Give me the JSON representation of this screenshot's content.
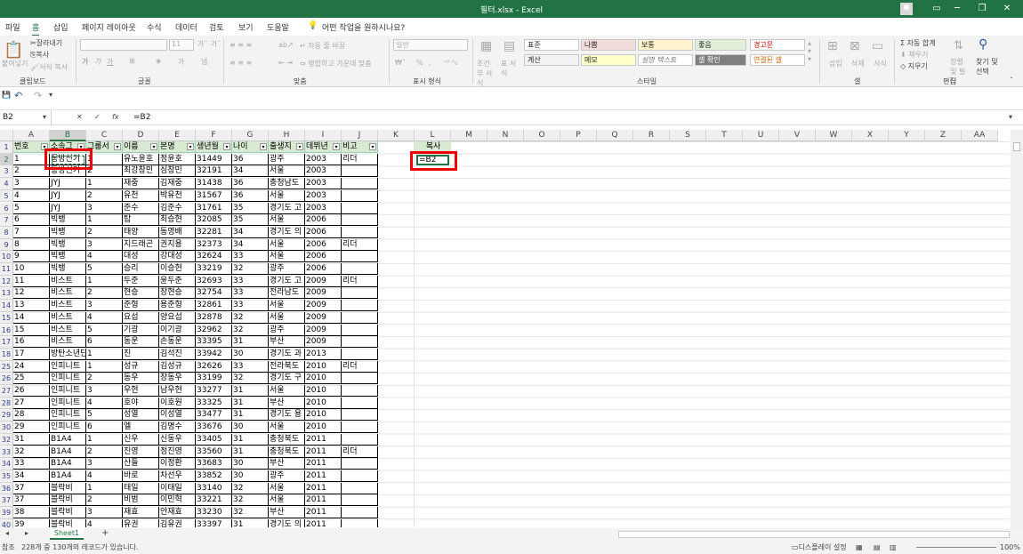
{
  "window": {
    "title": "필터.xlsx  -  Excel",
    "minimize": "─",
    "restore": "❐",
    "close": "✕",
    "ribbon_toggle": "▭"
  },
  "tabs": [
    "파일",
    "홈",
    "삽입",
    "페이지 레이아웃",
    "수식",
    "데이터",
    "검토",
    "보기",
    "도움말"
  ],
  "active_tab": "홈",
  "tell_me": "어떤 작업을 원하시나요?",
  "share": "공유",
  "ribbon": {
    "groups": [
      "클립보드",
      "글꼴",
      "맞춤",
      "표시 형식",
      "스타일",
      "셀",
      "편집"
    ],
    "clipboard": {
      "paste": "붙여넣기",
      "cut": "잘라내기",
      "copy": "복사",
      "format_painter": "서식 복사"
    },
    "font": {
      "name": "",
      "size": "11",
      "bold": "가",
      "italic": "가",
      "underline": "가"
    },
    "align": {
      "wrap": "자동 줄 바꿈",
      "merge": "병합하고 가운데 맞춤"
    },
    "number": {
      "format": "일반",
      "percent": "%"
    },
    "styles": {
      "conditional": "조건부 서식",
      "table": "표 서식",
      "cells": [
        "표준",
        "나쁨",
        "보통",
        "좋음",
        "경고문",
        "계산",
        "메모",
        "설명 텍스트",
        "셀 확인",
        "연결된 셀"
      ]
    },
    "cells": {
      "insert": "삽입",
      "delete": "삭제",
      "format": "서식"
    },
    "editing": {
      "autosum": "자동 합계",
      "fill": "채우기",
      "clear": "지우기",
      "sort": "정렬 및 필터",
      "find": "찾기 및 선택"
    }
  },
  "qat": {
    "save": "💾",
    "undo": "↶",
    "redo": "↷"
  },
  "formula_bar": {
    "name_box": "B2",
    "cancel": "✕",
    "enter": "✓",
    "fx": "fx",
    "formula": "=B2"
  },
  "columns": [
    "A",
    "B",
    "C",
    "D",
    "E",
    "F",
    "G",
    "H",
    "I",
    "J",
    "K",
    "L",
    "M",
    "N",
    "O",
    "P",
    "Q",
    "R",
    "S",
    "T",
    "U",
    "V",
    "W",
    "X",
    "Y",
    "Z",
    "AA"
  ],
  "headers": [
    "번호",
    "소속그",
    "그룹서",
    "이름",
    "본명",
    "생년월",
    "나이",
    "출생지",
    "데뷔년",
    "비고"
  ],
  "copy_label": "복사",
  "copy_cell": "=B2",
  "rows": [
    {
      "r": "1",
      "v": []
    },
    {
      "r": "2",
      "v": [
        "1",
        "동방신기",
        "1",
        "유노윤호",
        "정윤호",
        "31449",
        "36",
        "광주",
        "2003",
        "리더"
      ]
    },
    {
      "r": "3",
      "v": [
        "2",
        "동방신기",
        "2",
        "최강창민",
        "심창민",
        "32191",
        "34",
        "서울",
        "2003",
        ""
      ]
    },
    {
      "r": "4",
      "v": [
        "3",
        "JYJ",
        "1",
        "재중",
        "김재중",
        "31438",
        "36",
        "충청남도",
        "2003",
        ""
      ]
    },
    {
      "r": "5",
      "v": [
        "4",
        "JYJ",
        "2",
        "유천",
        "박유천",
        "31567",
        "36",
        "서울",
        "2003",
        ""
      ]
    },
    {
      "r": "6",
      "v": [
        "5",
        "JYJ",
        "3",
        "준수",
        "김준수",
        "31761",
        "35",
        "경기도 고",
        "2003",
        ""
      ]
    },
    {
      "r": "7",
      "v": [
        "6",
        "빅뱅",
        "1",
        "탑",
        "최승현",
        "32085",
        "35",
        "서울",
        "2006",
        ""
      ]
    },
    {
      "r": "8",
      "v": [
        "7",
        "빅뱅",
        "2",
        "태양",
        "동영배",
        "32281",
        "34",
        "경기도 의",
        "2006",
        ""
      ]
    },
    {
      "r": "9",
      "v": [
        "8",
        "빅뱅",
        "3",
        "지드래곤",
        "권지용",
        "32373",
        "34",
        "서울",
        "2006",
        "리더"
      ]
    },
    {
      "r": "10",
      "v": [
        "9",
        "빅뱅",
        "4",
        "대성",
        "강대성",
        "32624",
        "33",
        "서울",
        "2006",
        ""
      ]
    },
    {
      "r": "11",
      "v": [
        "10",
        "빅뱅",
        "5",
        "승리",
        "이승현",
        "33219",
        "32",
        "광주",
        "2006",
        ""
      ]
    },
    {
      "r": "12",
      "v": [
        "11",
        "비스트",
        "1",
        "두준",
        "윤두준",
        "32693",
        "33",
        "경기도 고",
        "2009",
        "리더"
      ]
    },
    {
      "r": "13",
      "v": [
        "12",
        "비스트",
        "2",
        "현승",
        "장현승",
        "32754",
        "33",
        "전라남도",
        "2009",
        ""
      ]
    },
    {
      "r": "14",
      "v": [
        "13",
        "비스트",
        "3",
        "준형",
        "용준형",
        "32861",
        "33",
        "서울",
        "2009",
        ""
      ]
    },
    {
      "r": "15",
      "v": [
        "14",
        "비스트",
        "4",
        "요섭",
        "양요섭",
        "32878",
        "32",
        "서울",
        "2009",
        ""
      ]
    },
    {
      "r": "16",
      "v": [
        "15",
        "비스트",
        "5",
        "기광",
        "이기광",
        "32962",
        "32",
        "광주",
        "2009",
        ""
      ]
    },
    {
      "r": "17",
      "v": [
        "16",
        "비스트",
        "6",
        "동운",
        "손동운",
        "33395",
        "31",
        "부산",
        "2009",
        ""
      ]
    },
    {
      "r": "18",
      "v": [
        "17",
        "방탄소년단",
        "1",
        "진",
        "김석진",
        "33942",
        "30",
        "경기도 과",
        "2013",
        ""
      ]
    },
    {
      "r": "25",
      "v": [
        "24",
        "인피니트",
        "1",
        "성규",
        "김성규",
        "32626",
        "33",
        "전라북도",
        "2010",
        "리더"
      ]
    },
    {
      "r": "26",
      "v": [
        "25",
        "인피니트",
        "2",
        "동우",
        "장동우",
        "33199",
        "32",
        "경기도 구",
        "2010",
        ""
      ]
    },
    {
      "r": "27",
      "v": [
        "26",
        "인피니트",
        "3",
        "우현",
        "남우현",
        "33277",
        "31",
        "서울",
        "2010",
        ""
      ]
    },
    {
      "r": "28",
      "v": [
        "27",
        "인피니트",
        "4",
        "호야",
        "이호원",
        "33325",
        "31",
        "부산",
        "2010",
        ""
      ]
    },
    {
      "r": "29",
      "v": [
        "28",
        "인피니트",
        "5",
        "성열",
        "이성열",
        "33477",
        "31",
        "경기도 용",
        "2010",
        ""
      ]
    },
    {
      "r": "30",
      "v": [
        "29",
        "인피니트",
        "6",
        "엘",
        "김명수",
        "33676",
        "30",
        "서울",
        "2010",
        ""
      ]
    },
    {
      "r": "32",
      "v": [
        "31",
        "B1A4",
        "1",
        "신우",
        "신동우",
        "33405",
        "31",
        "충청북도",
        "2011",
        ""
      ]
    },
    {
      "r": "33",
      "v": [
        "32",
        "B1A4",
        "2",
        "진영",
        "정진영",
        "33560",
        "31",
        "충청북도",
        "2011",
        "리더"
      ]
    },
    {
      "r": "34",
      "v": [
        "33",
        "B1A4",
        "3",
        "산들",
        "이정환",
        "33683",
        "30",
        "부산",
        "2011",
        ""
      ]
    },
    {
      "r": "35",
      "v": [
        "34",
        "B1A4",
        "4",
        "바로",
        "차선우",
        "33852",
        "30",
        "광주",
        "2011",
        ""
      ]
    },
    {
      "r": "36",
      "v": [
        "37",
        "블락비",
        "1",
        "태일",
        "이태일",
        "33140",
        "32",
        "서울",
        "2011",
        ""
      ]
    },
    {
      "r": "37",
      "v": [
        "37",
        "블락비",
        "2",
        "비범",
        "이민혁",
        "33221",
        "32",
        "서울",
        "2011",
        ""
      ]
    },
    {
      "r": "39",
      "v": [
        "38",
        "블락비",
        "3",
        "재효",
        "안재효",
        "33230",
        "32",
        "부산",
        "2011",
        ""
      ]
    },
    {
      "r": "40",
      "v": [
        "39",
        "블락비",
        "4",
        "유권",
        "김유권",
        "33397",
        "31",
        "경기도 의",
        "2011",
        ""
      ]
    }
  ],
  "sheet": {
    "name": "Sheet1",
    "add": "+"
  },
  "status": {
    "mode": "참조",
    "records": "228개 중 130개의 레코드가 있습니다.",
    "display": "디스플레이 설정",
    "zoom": "100%"
  }
}
